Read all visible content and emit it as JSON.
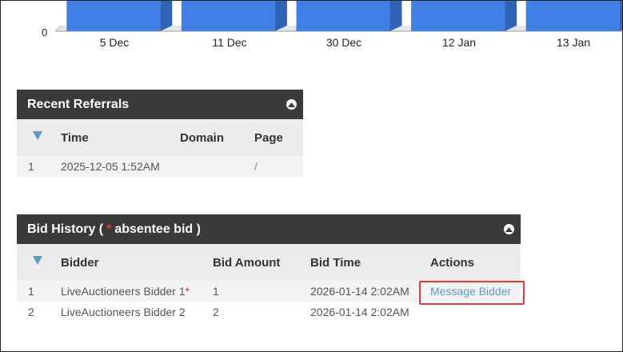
{
  "chart_data": {
    "type": "bar",
    "categories": [
      "5 Dec",
      "11 Dec",
      "30 Dec",
      "12 Jan",
      "13 Jan"
    ],
    "y_tick_visible": "0",
    "bar_color": "#3f7fe6"
  },
  "referrals": {
    "title": "Recent Referrals",
    "columns": [
      "Time",
      "Domain",
      "Page"
    ],
    "rows": [
      {
        "num": "1",
        "time": "2025-12-05 1:52AM",
        "domain": "",
        "page": "/"
      }
    ]
  },
  "bids": {
    "title_prefix": "Bid History (",
    "title_star": "*",
    "title_suffix": "absentee bid )",
    "columns": [
      "Bidder",
      "Bid Amount",
      "Bid Time",
      "Actions"
    ],
    "rows": [
      {
        "num": "1",
        "bidder": "LiveAuctioneers Bidder 1",
        "star": "*",
        "amount": "1",
        "time": "2026-01-14 2:02AM",
        "action": "Message Bidder"
      },
      {
        "num": "2",
        "bidder": "LiveAuctioneers Bidder 2",
        "star": "",
        "amount": "2",
        "time": "2026-01-14 2:02AM",
        "action": ""
      }
    ]
  },
  "colors": {
    "header_bg": "#3a3a3a",
    "sort_icon": "#5b9bc0",
    "link": "#5b9bc0",
    "highlight": "#e53935"
  }
}
